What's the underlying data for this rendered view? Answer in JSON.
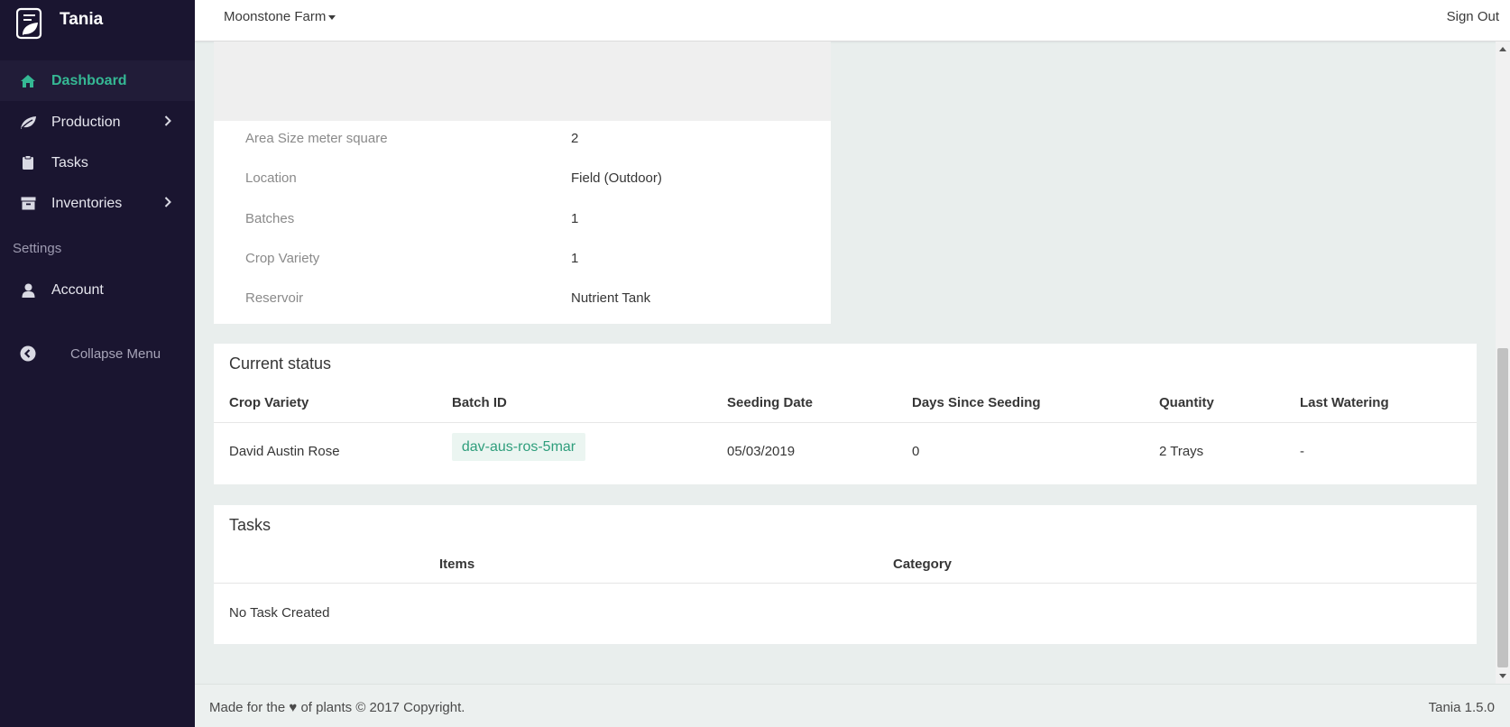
{
  "brand": {
    "name": "Tania"
  },
  "sidebar": {
    "items": [
      {
        "label": "Dashboard",
        "icon": "home-icon"
      },
      {
        "label": "Production",
        "icon": "leaf-icon"
      },
      {
        "label": "Tasks",
        "icon": "clipboard-icon"
      },
      {
        "label": "Inventories",
        "icon": "archive-icon"
      }
    ],
    "section_label": "Settings",
    "account": {
      "label": "Account",
      "icon": "user-icon"
    },
    "collapse_label": "Collapse Menu",
    "active_color": "#35b894",
    "background_color": "#1a1530"
  },
  "topbar": {
    "farm": "Moonstone Farm",
    "signout": "Sign Out"
  },
  "area_info": {
    "rows": [
      {
        "key": "Area Size meter square",
        "value": "2"
      },
      {
        "key": "Location",
        "value": "Field (Outdoor)"
      },
      {
        "key": "Batches",
        "value": "1"
      },
      {
        "key": "Crop Variety",
        "value": "1"
      },
      {
        "key": "Reservoir",
        "value": "Nutrient Tank"
      }
    ]
  },
  "current_status": {
    "title": "Current status",
    "headers": [
      "Crop Variety",
      "Batch ID",
      "Seeding Date",
      "Days Since Seeding",
      "Quantity",
      "Last Watering"
    ],
    "row": {
      "crop_variety": "David Austin Rose",
      "batch_id": "dav-aus-ros-5mar",
      "seeding_date": "05/03/2019",
      "days_since_seeding": "0",
      "quantity": "2 Trays",
      "last_watering": "-"
    }
  },
  "tasks": {
    "title": "Tasks",
    "headers": [
      "Items",
      "Category"
    ],
    "empty_text": "No Task Created"
  },
  "footer": {
    "left": "Made for the ♥ of plants © 2017 Copyright.",
    "right": "Tania 1.5.0"
  }
}
